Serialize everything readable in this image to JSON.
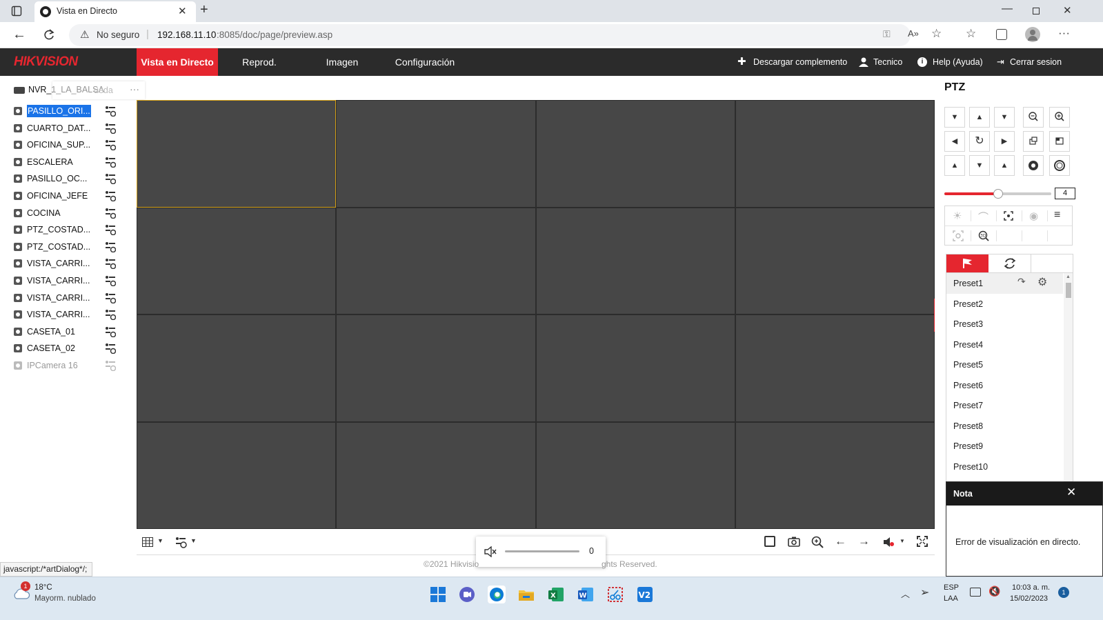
{
  "browser": {
    "tab_title": "Vista en Directo",
    "security_label": "No seguro",
    "url_host": "192.168.11.10",
    "url_rest": ":8085/doc/page/preview.asp"
  },
  "app": {
    "logo": "HIKVISION",
    "nav": [
      "Vista en Directo",
      "Reprod.",
      "Imagen",
      "Configuración"
    ],
    "header_right": {
      "plugin": "Descargar complemento",
      "user": "Tecnico",
      "help": "Help (Ayuda)",
      "logout": "Cerrar sesion"
    }
  },
  "tree": {
    "device": "NVR_1_LA_BALSA",
    "search_ghost": "ueda",
    "cameras": [
      {
        "label": "PASILLO_ORI...",
        "selected": true,
        "disabled": false
      },
      {
        "label": "CUARTO_DAT...",
        "selected": false,
        "disabled": false
      },
      {
        "label": "OFICINA_SUP...",
        "selected": false,
        "disabled": false
      },
      {
        "label": "ESCALERA",
        "selected": false,
        "disabled": false
      },
      {
        "label": "PASILLO_OC...",
        "selected": false,
        "disabled": false
      },
      {
        "label": "OFICINA_JEFE",
        "selected": false,
        "disabled": false
      },
      {
        "label": "COCINA",
        "selected": false,
        "disabled": false
      },
      {
        "label": "PTZ_COSTAD...",
        "selected": false,
        "disabled": false
      },
      {
        "label": "PTZ_COSTAD...",
        "selected": false,
        "disabled": false
      },
      {
        "label": "VISTA_CARRI...",
        "selected": false,
        "disabled": false
      },
      {
        "label": "VISTA_CARRI...",
        "selected": false,
        "disabled": false
      },
      {
        "label": "VISTA_CARRI...",
        "selected": false,
        "disabled": false
      },
      {
        "label": "VISTA_CARRI...",
        "selected": false,
        "disabled": false
      },
      {
        "label": "CASETA_01",
        "selected": false,
        "disabled": false
      },
      {
        "label": "CASETA_02",
        "selected": false,
        "disabled": false
      },
      {
        "label": "IPCamera 16",
        "selected": false,
        "disabled": true
      }
    ]
  },
  "ptz": {
    "title": "PTZ",
    "speed_value": "4",
    "speed_fraction": 0.5,
    "presets": [
      "Preset1",
      "Preset2",
      "Preset3",
      "Preset4",
      "Preset5",
      "Preset6",
      "Preset7",
      "Preset8",
      "Preset9",
      "Preset10"
    ]
  },
  "volume": {
    "value": "0"
  },
  "nota": {
    "title": "Nota",
    "message": "Error de visualización en directo."
  },
  "footer": {
    "copyright_left": "©2021 Hikvisio",
    "copyright_right": "ghts Reserved."
  },
  "statusbar": {
    "url": "javascript:/*artDialog*/;"
  },
  "taskbar": {
    "weather_temp": "18°C",
    "weather_desc": "Mayorm. nublado",
    "weather_badge": "1",
    "lang_top": "ESP",
    "lang_bottom": "LAA",
    "time": "10:03 a. m.",
    "date": "15/02/2023",
    "notif_count": "1"
  },
  "colors": {
    "accent_red": "#e5262f",
    "header_dark": "#2b2b2b",
    "grid_gray": "#474747",
    "selection_blue": "#1a73e8",
    "active_cell": "#d4a017"
  }
}
